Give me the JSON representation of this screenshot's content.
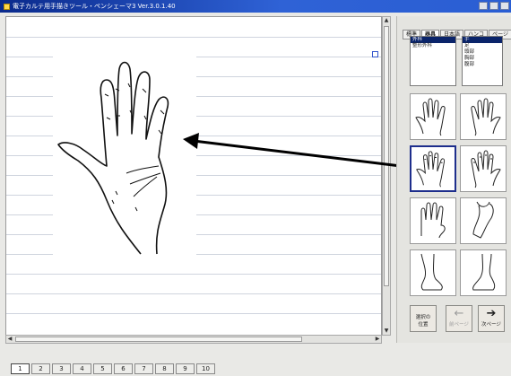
{
  "window": {
    "title": "電子カルテ用手描きツール・ペンシェーマ3 Ver.3.0.1.40"
  },
  "panel": {
    "tabs": [
      {
        "label": "標準",
        "active": false
      },
      {
        "label": "器具",
        "active": true
      },
      {
        "label": "日本語",
        "active": false
      },
      {
        "label": "ハンコ",
        "active": false
      },
      {
        "label": "ページ",
        "active": false
      }
    ],
    "category_list": [
      {
        "label": "外科",
        "selected": true
      },
      {
        "label": "整形外科",
        "selected": false
      }
    ],
    "part_list": [
      {
        "label": "手",
        "selected": true
      },
      {
        "label": "足",
        "selected": false
      },
      {
        "label": "頭部",
        "selected": false
      },
      {
        "label": "胸部",
        "selected": false
      },
      {
        "label": "腹部",
        "selected": false
      }
    ],
    "thumbnails": [
      {
        "name": "hand-palm-left"
      },
      {
        "name": "hand-palm-right"
      },
      {
        "name": "hand-back-left",
        "selected": true
      },
      {
        "name": "hand-back-right"
      },
      {
        "name": "hand-fingers"
      },
      {
        "name": "leg-side"
      },
      {
        "name": "foot-left"
      },
      {
        "name": "foot-right"
      }
    ],
    "buttons": {
      "insert": "選択の\n位置",
      "prev": "前ページ",
      "next": "次ページ"
    }
  },
  "pager": {
    "pages": [
      "1",
      "2",
      "3",
      "4",
      "5",
      "6",
      "7",
      "8",
      "9",
      "10"
    ],
    "current": "1"
  }
}
